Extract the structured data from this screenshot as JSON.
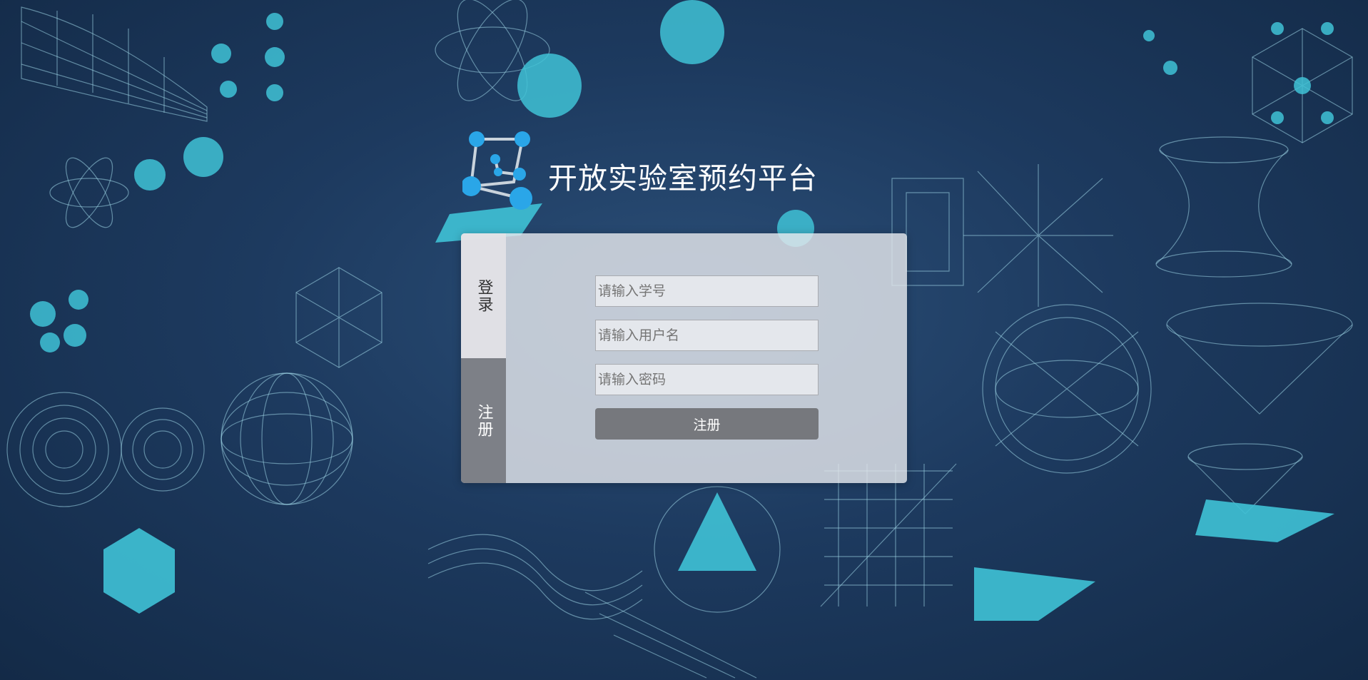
{
  "brand": {
    "title": "开放实验室预约平台",
    "logo_icon": "molecule-cube-icon",
    "logo_color": "#2aa6e8"
  },
  "tabs": [
    {
      "label": "登录",
      "active": false
    },
    {
      "label": "注册",
      "active": true
    }
  ],
  "form": {
    "student_id_placeholder": "请输入学号",
    "username_placeholder": "请输入用户名",
    "password_placeholder": "请输入密码",
    "submit_label": "注册"
  },
  "colors": {
    "background": "#1d3a5f",
    "accent": "#3fc2d6",
    "active_tab": "#7d8087",
    "button": "#76787d"
  }
}
